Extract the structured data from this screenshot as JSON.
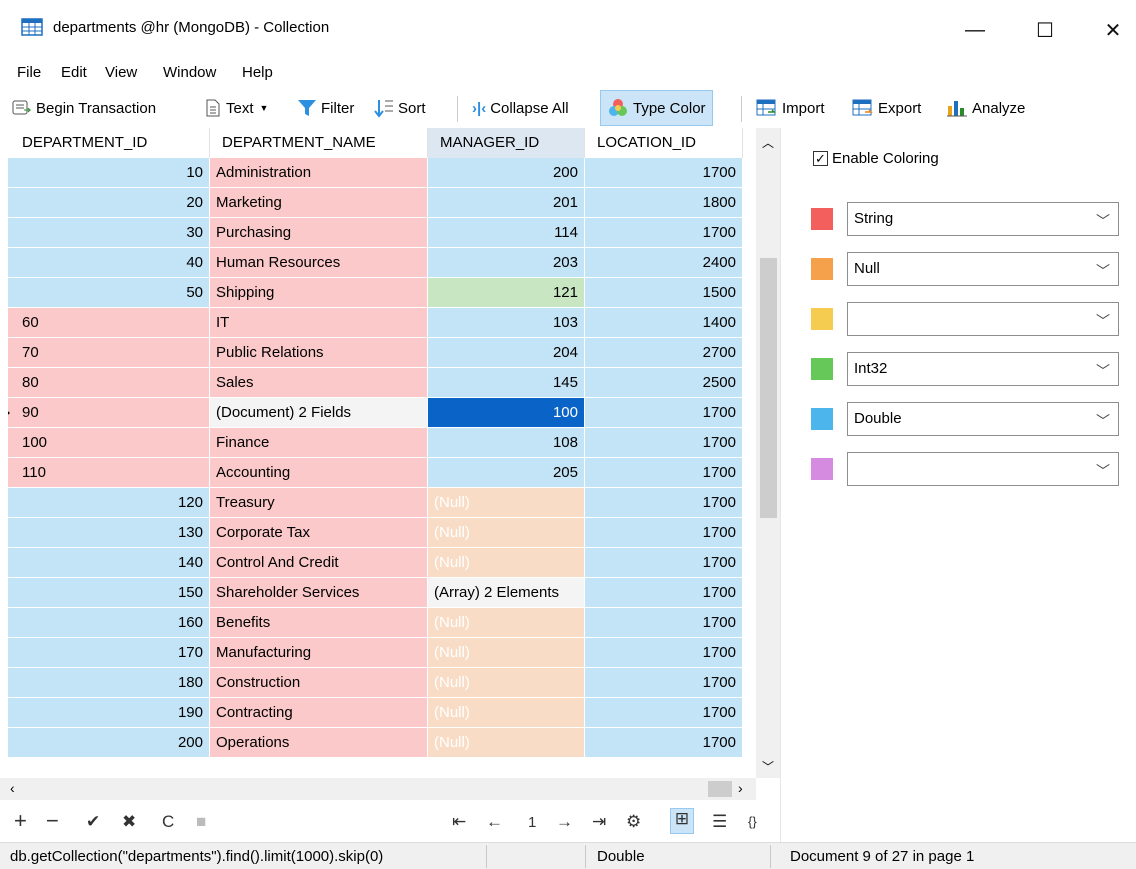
{
  "window": {
    "title": "departments @hr (MongoDB) - Collection",
    "min_glyph": "—",
    "max_glyph": "☐",
    "close_glyph": "✕"
  },
  "menu": [
    "File",
    "Edit",
    "View",
    "Window",
    "Help"
  ],
  "toolbar": {
    "begin_transaction": "Begin Transaction",
    "text": "Text",
    "filter": "Filter",
    "sort": "Sort",
    "collapse_all": "Collapse All",
    "type_color": "Type Color",
    "import": "Import",
    "export": "Export",
    "analyze": "Analyze"
  },
  "grid": {
    "columns": [
      "DEPARTMENT_ID",
      "DEPARTMENT_NAME",
      "MANAGER_ID",
      "LOCATION_ID"
    ],
    "rows": [
      {
        "id": "10",
        "id_type": "double",
        "name": "Administration",
        "manager": "200",
        "manager_type": "double",
        "location": "1700"
      },
      {
        "id": "20",
        "id_type": "double",
        "name": "Marketing",
        "manager": "201",
        "manager_type": "double",
        "location": "1800"
      },
      {
        "id": "30",
        "id_type": "double",
        "name": "Purchasing",
        "manager": "114",
        "manager_type": "double",
        "location": "1700"
      },
      {
        "id": "40",
        "id_type": "double",
        "name": "Human Resources",
        "manager": "203",
        "manager_type": "double",
        "location": "2400"
      },
      {
        "id": "50",
        "id_type": "double",
        "name": "Shipping",
        "manager": "121",
        "manager_type": "int32",
        "location": "1500"
      },
      {
        "id": "60",
        "id_type": "string",
        "name": "IT",
        "manager": "103",
        "manager_type": "double",
        "location": "1400"
      },
      {
        "id": "70",
        "id_type": "string",
        "name": "Public Relations",
        "manager": "204",
        "manager_type": "double",
        "location": "2700"
      },
      {
        "id": "80",
        "id_type": "string",
        "name": "Sales",
        "manager": "145",
        "manager_type": "double",
        "location": "2500"
      },
      {
        "id": "90",
        "id_type": "string",
        "name": "(Document) 2 Fields",
        "name_type": "document",
        "manager": "100",
        "manager_type": "selected",
        "location": "1700",
        "current": true
      },
      {
        "id": "100",
        "id_type": "string",
        "name": "Finance",
        "manager": "108",
        "manager_type": "double",
        "location": "1700"
      },
      {
        "id": "110",
        "id_type": "string",
        "name": "Accounting",
        "manager": "205",
        "manager_type": "double",
        "location": "1700"
      },
      {
        "id": "120",
        "id_type": "double",
        "name": "Treasury",
        "manager": "(Null)",
        "manager_type": "null",
        "location": "1700"
      },
      {
        "id": "130",
        "id_type": "double",
        "name": "Corporate Tax",
        "manager": "(Null)",
        "manager_type": "null",
        "location": "1700"
      },
      {
        "id": "140",
        "id_type": "double",
        "name": "Control And Credit",
        "manager": "(Null)",
        "manager_type": "null",
        "location": "1700"
      },
      {
        "id": "150",
        "id_type": "double",
        "name": "Shareholder Services",
        "manager": "(Array) 2 Elements",
        "manager_type": "array",
        "location": "1700"
      },
      {
        "id": "160",
        "id_type": "double",
        "name": "Benefits",
        "manager": "(Null)",
        "manager_type": "null",
        "location": "1700"
      },
      {
        "id": "170",
        "id_type": "double",
        "name": "Manufacturing",
        "manager": "(Null)",
        "manager_type": "null",
        "location": "1700"
      },
      {
        "id": "180",
        "id_type": "double",
        "name": "Construction",
        "manager": "(Null)",
        "manager_type": "null",
        "location": "1700"
      },
      {
        "id": "190",
        "id_type": "double",
        "name": "Contracting",
        "manager": "(Null)",
        "manager_type": "null",
        "location": "1700"
      },
      {
        "id": "200",
        "id_type": "double",
        "name": "Operations",
        "manager": "(Null)",
        "manager_type": "null",
        "location": "1700"
      }
    ]
  },
  "pager": {
    "page": "1"
  },
  "status": {
    "query": "db.getCollection(\"departments\").find().limit(1000).skip(0)",
    "type": "Double",
    "position": "Document 9 of 27 in page 1"
  },
  "coloring": {
    "enable_label": "Enable Coloring",
    "enabled": true,
    "rules": [
      {
        "color": "#f25f5c",
        "type": "String"
      },
      {
        "color": "#f5a04a",
        "type": "Null"
      },
      {
        "color": "#f5cc4f",
        "type": ""
      },
      {
        "color": "#67c85a",
        "type": "Int32"
      },
      {
        "color": "#4cb5ec",
        "type": "Double"
      },
      {
        "color": "#d58be0",
        "type": ""
      }
    ]
  },
  "colors": {
    "double": "#c3e4f6",
    "string": "#fbc9c9",
    "null": "#f9dcc5",
    "int32": "#c9e6c2",
    "selected": "#0a64c8"
  }
}
